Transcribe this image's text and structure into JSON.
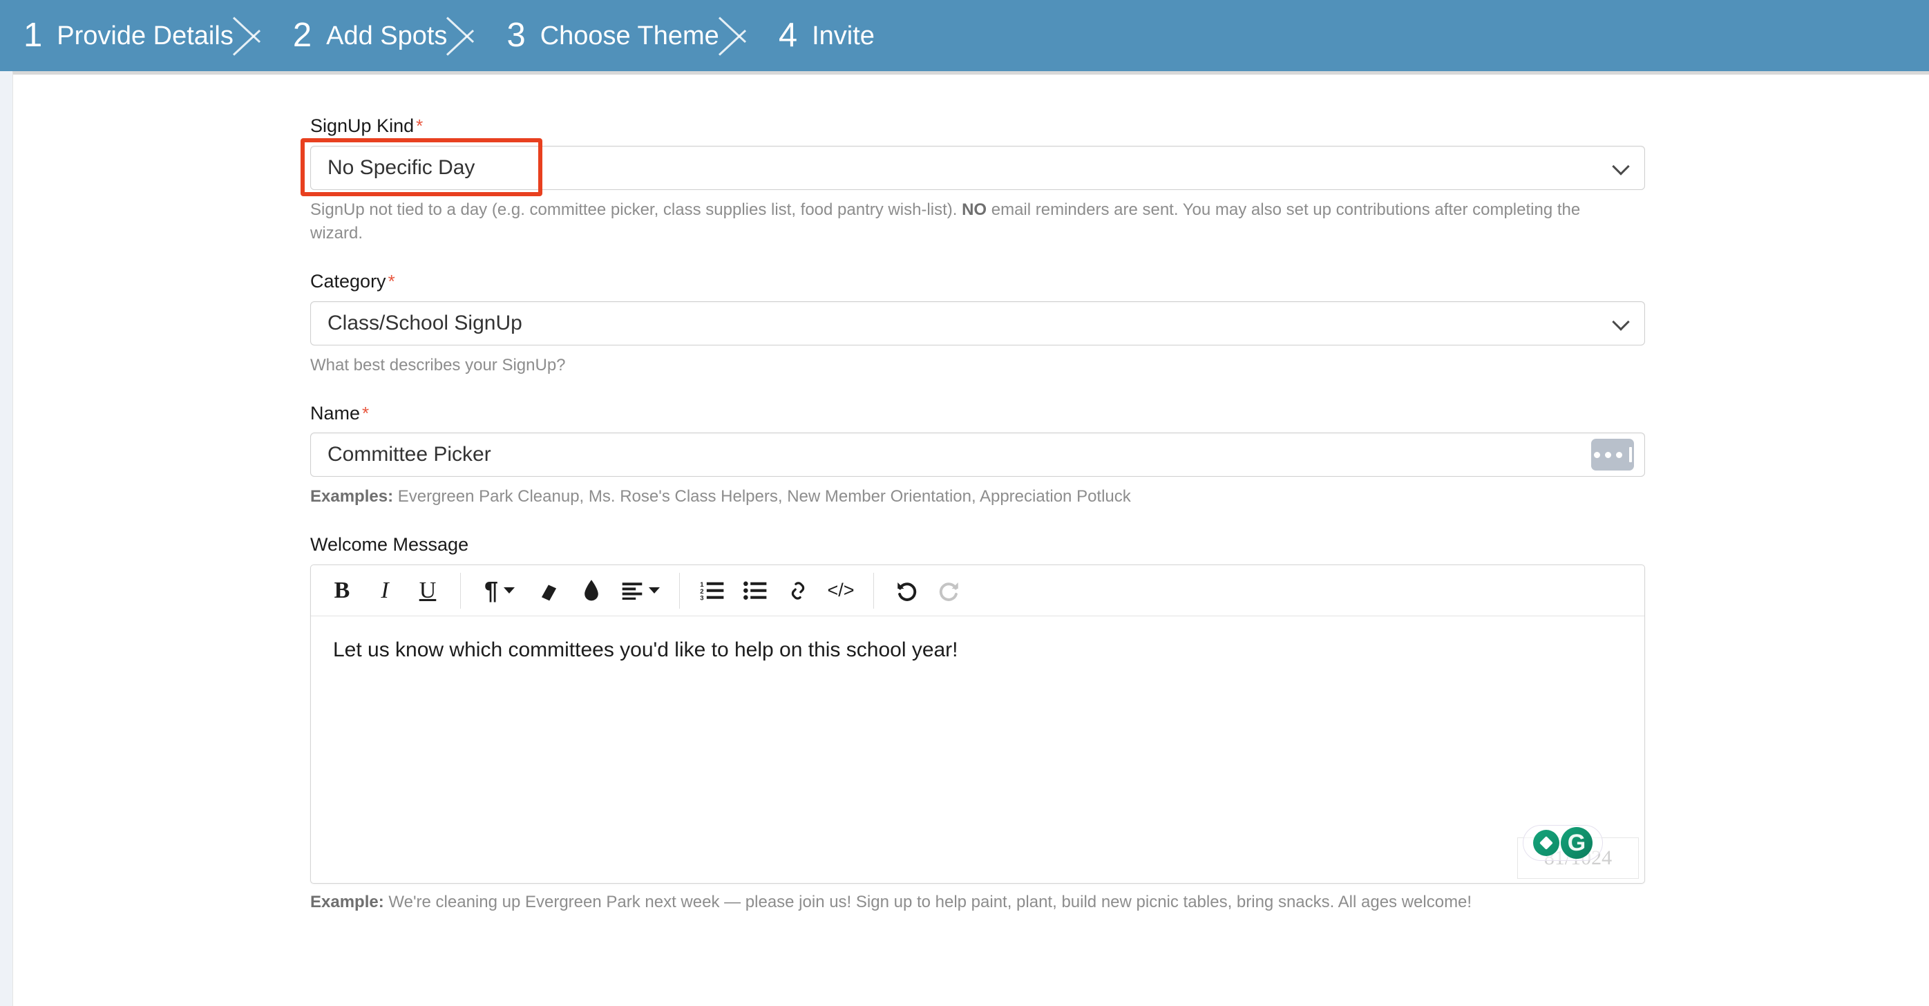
{
  "wizard": {
    "steps": [
      {
        "number": "1",
        "label": "Provide Details"
      },
      {
        "number": "2",
        "label": "Add Spots"
      },
      {
        "number": "3",
        "label": "Choose Theme"
      },
      {
        "number": "4",
        "label": "Invite"
      }
    ],
    "active_step": 1,
    "bar_color": "#5191ba"
  },
  "form": {
    "signup_kind": {
      "label": "SignUp Kind",
      "required_marker": "*",
      "value": "No Specific Day",
      "helper_text": "SignUp not tied to a day (e.g. committee picker, class supplies list, food pantry wish-list). ",
      "helper_bold": "NO",
      "helper_text_2": " email reminders are sent. You may also set up contributions after completing the wizard.",
      "highlight_color": "#e8401f"
    },
    "category": {
      "label": "Category",
      "required_marker": "*",
      "value": "Class/School SignUp",
      "helper_text": "What best describes your SignUp?"
    },
    "name": {
      "label": "Name",
      "required_marker": "*",
      "value": "Committee Picker",
      "examples_lead": "Examples:",
      "examples_text": " Evergreen Park Cleanup, Ms. Rose's Class Helpers, New Member Orientation, Appreciation Potluck"
    },
    "welcome_message": {
      "label": "Welcome Message",
      "body": "Let us know which committees you'd like to help on this school year!",
      "char_counter": "81/1024",
      "grammarly_logo": "G",
      "example_lead": "Example:",
      "example_text": " We're cleaning up Evergreen Park next week — please join us! Sign up to help paint, plant, build new picnic tables, bring snacks. All ages welcome!",
      "toolbar": [
        {
          "name": "bold",
          "glyph": "B"
        },
        {
          "name": "italic",
          "glyph": "I"
        },
        {
          "name": "underline",
          "glyph": "U"
        },
        {
          "name": "paragraph-format",
          "glyph": "¶"
        },
        {
          "name": "clear-formatting",
          "glyph": "eraser"
        },
        {
          "name": "text-color",
          "glyph": "droplet"
        },
        {
          "name": "align",
          "glyph": "align-left"
        },
        {
          "name": "ordered-list",
          "glyph": "123-list"
        },
        {
          "name": "unordered-list",
          "glyph": "bullet-list"
        },
        {
          "name": "insert-link",
          "glyph": "chain"
        },
        {
          "name": "code-view",
          "glyph": "</>"
        },
        {
          "name": "undo",
          "glyph": "undo-arrow"
        },
        {
          "name": "redo",
          "glyph": "redo-arrow"
        }
      ]
    }
  }
}
